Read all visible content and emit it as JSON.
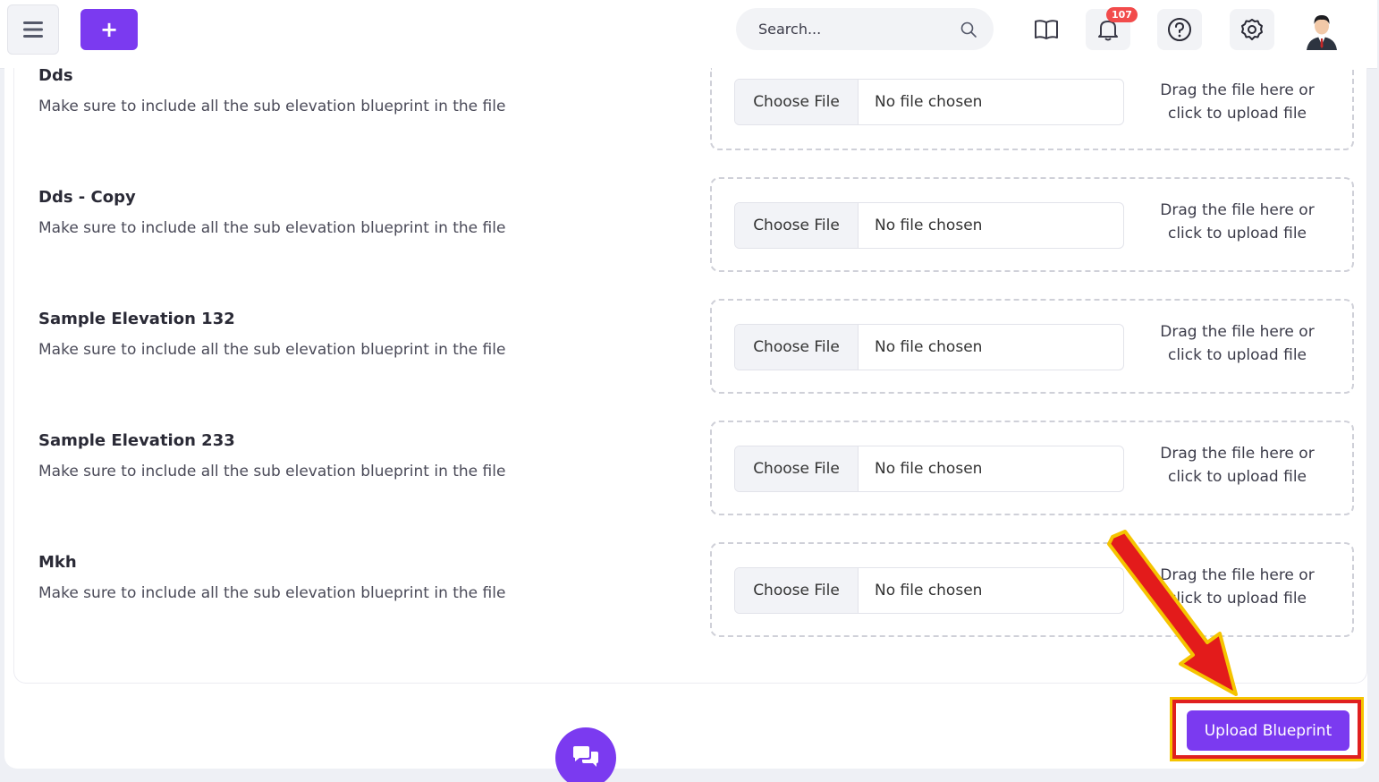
{
  "header": {
    "search_placeholder": "Search...",
    "notifications_count": "107"
  },
  "rows": [
    {
      "title": "Dds",
      "description": "Make sure to include all the sub elevation blueprint in the file"
    },
    {
      "title": "Dds - Copy",
      "description": "Make sure to include all the sub elevation blueprint in the file"
    },
    {
      "title": "Sample Elevation 132",
      "description": "Make sure to include all the sub elevation blueprint in the file"
    },
    {
      "title": "Sample Elevation 233",
      "description": "Make sure to include all the sub elevation blueprint in the file"
    },
    {
      "title": "Mkh",
      "description": "Make sure to include all the sub elevation blueprint in the file"
    }
  ],
  "file_input": {
    "choose_label": "Choose File",
    "no_file_label": "No file chosen",
    "drag_line1": "Drag the file here or",
    "drag_line2": "click to upload file"
  },
  "upload_button_label": "Upload Blueprint",
  "colors": {
    "accent": "#7b3af0",
    "badge": "#f24b4b",
    "highlight_red": "#e02020",
    "highlight_yellow": "#f5c400"
  }
}
